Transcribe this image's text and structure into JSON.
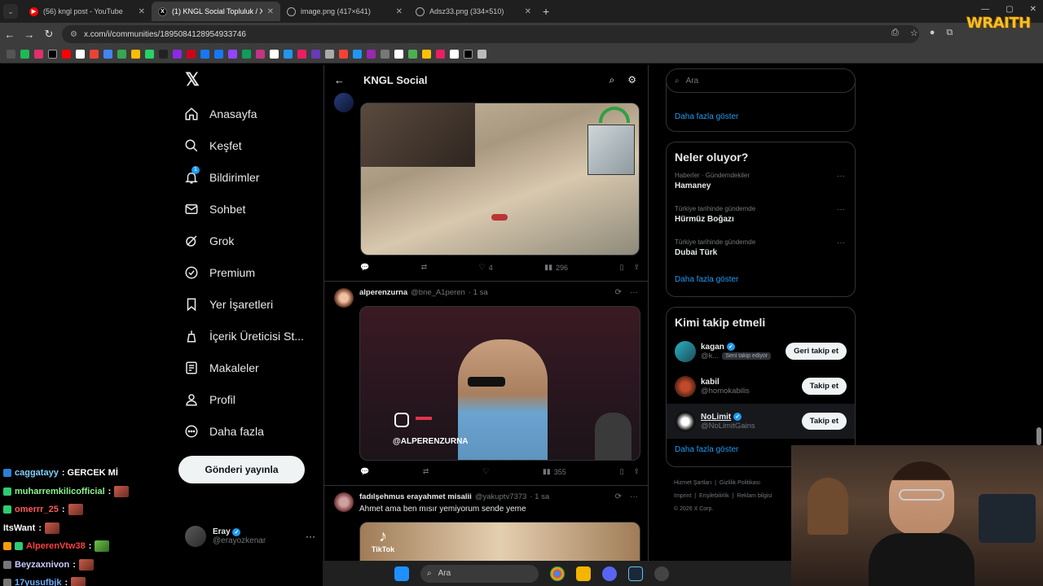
{
  "browser": {
    "tabs": [
      {
        "title": "(56) kngl post - YouTube",
        "favicon": "youtube-icon",
        "color": "#ff0000"
      },
      {
        "title": "(1) KNGL Social Topluluk / X",
        "favicon": "x-icon",
        "color": "#000000"
      },
      {
        "title": "image.png (417×641)",
        "favicon": "globe-icon",
        "color": "#888888"
      },
      {
        "title": "Adsz33.png (334×510)",
        "favicon": "globe-icon",
        "color": "#888888"
      }
    ],
    "url": "x.com/i/communities/1895084128954933746"
  },
  "watermark": "WRAITH",
  "sidebar": {
    "items": [
      {
        "label": "Anasayfa",
        "icon": "home-icon"
      },
      {
        "label": "Keşfet",
        "icon": "search-icon"
      },
      {
        "label": "Bildirimler",
        "icon": "bell-icon",
        "badge": "1"
      },
      {
        "label": "Sohbet",
        "icon": "mail-icon"
      },
      {
        "label": "Grok",
        "icon": "grok-icon"
      },
      {
        "label": "Premium",
        "icon": "premium-icon"
      },
      {
        "label": "Yer İşaretleri",
        "icon": "bookmark-icon"
      },
      {
        "label": "İçerik Üreticisi St...",
        "icon": "creator-icon"
      },
      {
        "label": "Makaleler",
        "icon": "article-icon"
      },
      {
        "label": "Profil",
        "icon": "profile-icon"
      },
      {
        "label": "Daha fazla",
        "icon": "more-icon"
      }
    ],
    "post_button": "Gönderi yayınla",
    "account": {
      "name": "Eray",
      "handle": "@erayozkenar"
    }
  },
  "main": {
    "title": "KNGL Social",
    "tweet1": {
      "likes": "4",
      "views": "296"
    },
    "tweet2": {
      "name": "alperenzurna",
      "handle": "@bne_A1peren",
      "time": "· 1 sa",
      "media_caption": "@ALPERENZURNA",
      "views": "355"
    },
    "tweet3": {
      "name": "fadılşehmus erayahmet misalii",
      "handle": "@yakuptv7373",
      "time": "· 1 sa",
      "text": "Ahmet ama ben mısır yemiyorum sende yeme",
      "media_caption": "TikTok"
    }
  },
  "right": {
    "search_placeholder": "Ara",
    "show_more": "Daha fazla göster",
    "trends_title": "Neler oluyor?",
    "trends": [
      {
        "category": "Haberler · Gündemdekiler",
        "title": "Hamaney"
      },
      {
        "category": "Türkiye tarihinde gündemde",
        "title": "Hürmüz Boğazı"
      },
      {
        "category": "Türkiye tarihinde gündemde",
        "title": "Dubai Türk"
      }
    ],
    "who_title": "Kimi takip etmeli",
    "who": [
      {
        "name": "kagan",
        "handle": "@k...",
        "pill": "Seni takip ediyor",
        "button": "Geri takip et",
        "verified": true
      },
      {
        "name": "kabil",
        "handle": "@homokabilis",
        "button": "Takip et",
        "verified": false
      },
      {
        "name": "NoLimit",
        "handle": "@NoLimitGains",
        "button": "Takip et",
        "verified": true
      }
    ],
    "footer": [
      "Hizmet Şartları",
      "Gizlilik Politikası",
      "Imprint",
      "Erişilebilirlik",
      "Reklam bilgisi",
      "© 2026 X Corp."
    ]
  },
  "chat": [
    {
      "user": "caggatayy",
      "color": "#7fd0ff",
      "msg": " : GERCEK Mİ"
    },
    {
      "user": "muharremkilicofficial",
      "color": "#8cf58c",
      "msg": " :"
    },
    {
      "user": "omerrr_25",
      "color": "#ff5a5a",
      "msg": " :"
    },
    {
      "user": "ItsWant",
      "color": "#ffffff",
      "msg": " :"
    },
    {
      "user": "AlperenVtw38",
      "color": "#ff4040",
      "msg": " :"
    },
    {
      "user": "Beyzaxnivon",
      "color": "#c8c8ff",
      "msg": " :"
    },
    {
      "user": "17yusufbjk",
      "color": "#6ab0ff",
      "msg": " :"
    }
  ],
  "taskbar": {
    "search": "Ara"
  }
}
